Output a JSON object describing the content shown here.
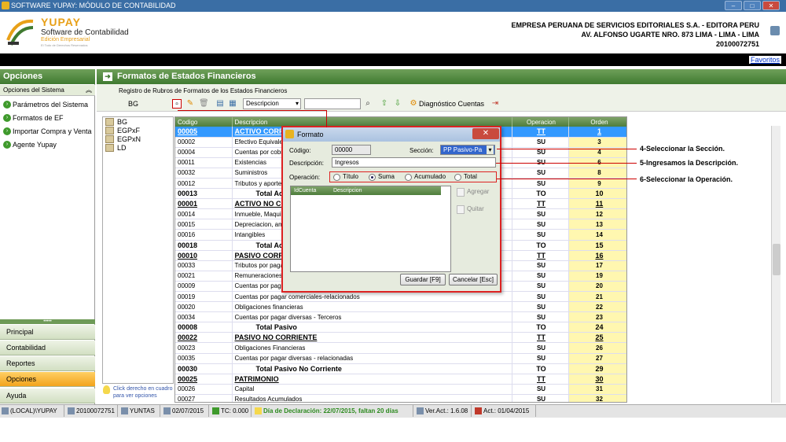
{
  "window": {
    "title": "SOFTWARE YUPAY: MÓDULO DE CONTABILIDAD",
    "min": "–",
    "max": "□",
    "close": "✕"
  },
  "brand": {
    "name": "YUPAY",
    "subtitle": "Software de Contabilidad",
    "edition": "Edición Empresarial",
    "tagline": "El Todo de Derechos Reservados"
  },
  "company": {
    "name": "EMPRESA PERUANA DE SERVICIOS EDITORIALES S.A. - EDITORA PERU",
    "address": "AV. ALFONSO UGARTE NRO. 873 LIMA - LIMA - LIMA",
    "ruc": "20100072751"
  },
  "favoritos": "Favoritos",
  "sidebar": {
    "header": "Opciones",
    "section": "Opciones del Sistema",
    "items": [
      {
        "label": "Parámetros del Sistema"
      },
      {
        "label": "Formatos de EF"
      },
      {
        "label": "Importar Compra y Venta"
      },
      {
        "label": "Agente Yupay"
      }
    ],
    "nav": [
      {
        "label": "Principal"
      },
      {
        "label": "Contabilidad"
      },
      {
        "label": "Reportes"
      },
      {
        "label": "Opciones"
      },
      {
        "label": "Ayuda"
      }
    ]
  },
  "main": {
    "title": "Formatos de Estados Financieros",
    "subtitle": "Registro de Rubros de Formatos de los Estados Financieros",
    "current_format": "BG",
    "search_field": "Descripcion",
    "diag": "Diagnóstico Cuentas"
  },
  "tree": [
    "BG",
    "EGPxF",
    "EGPxN",
    "LD"
  ],
  "hint": "Click derecho en cuadro para ver opciones",
  "grid": {
    "headers": [
      "Codigo",
      "Descripcion",
      "Operacion",
      "Orden"
    ],
    "rows": [
      [
        "00005",
        "ACTIVO CORRIENTE",
        "TT",
        "1"
      ],
      [
        "00002",
        "Efectivo Equivalente de Efectivo",
        "SU",
        "3"
      ],
      [
        "00004",
        "Cuentas por cobrar",
        "SU",
        "4"
      ],
      [
        "00011",
        "Existencias",
        "SU",
        "6"
      ],
      [
        "00032",
        "Suministros",
        "SU",
        "8"
      ],
      [
        "00012",
        "Tributos y aportes",
        "SU",
        "9"
      ],
      [
        "00013",
        "Total Activo Corriente",
        "TO",
        "10"
      ],
      [
        "00001",
        "ACTIVO NO CORRIENTE",
        "TT",
        "11"
      ],
      [
        "00014",
        "Inmueble, Maquinaria y Equipo",
        "SU",
        "12"
      ],
      [
        "00015",
        "Depreciacion, amortizacion",
        "SU",
        "13"
      ],
      [
        "00016",
        "Intangibles",
        "SU",
        "14"
      ],
      [
        "00018",
        "Total Activo No Corriente",
        "TO",
        "15"
      ],
      [
        "00010",
        "PASIVO CORRIENTE",
        "TT",
        "16"
      ],
      [
        "00033",
        "Tributos por pagar",
        "SU",
        "17"
      ],
      [
        "00021",
        "Remuneraciones",
        "SU",
        "19"
      ],
      [
        "00009",
        "Cuentas por pagar",
        "SU",
        "20"
      ],
      [
        "00019",
        "Cuentas por pagar comerciales-relacionados",
        "SU",
        "21"
      ],
      [
        "00020",
        "Obligaciones financieras",
        "SU",
        "22"
      ],
      [
        "00034",
        "Cuentas por pagar diversas - Terceros",
        "SU",
        "23"
      ],
      [
        "00008",
        "Total Pasivo",
        "TO",
        "24"
      ],
      [
        "00022",
        "PASIVO NO CORRIENTE",
        "TT",
        "25"
      ],
      [
        "00023",
        "Obligaciones Financieras",
        "SU",
        "26"
      ],
      [
        "00035",
        "Cuentas por pagar diversas - relacionadas",
        "SU",
        "27"
      ],
      [
        "00030",
        "Total Pasivo No Corriente",
        "TO",
        "29"
      ],
      [
        "00025",
        "PATRIMONIO",
        "TT",
        "30"
      ],
      [
        "00026",
        "Capital",
        "SU",
        "31"
      ],
      [
        "00027",
        "Resultados Acumulados",
        "SU",
        "32"
      ]
    ]
  },
  "dialog": {
    "title": "Formato",
    "codigo_label": "Código:",
    "codigo": "00000",
    "seccion_label": "Sección:",
    "seccion": "PP  Pasivo-Pa",
    "desc_label": "Descripción:",
    "desc": "Ingresos",
    "op_label": "Operación:",
    "ops": [
      "Título",
      "Suma",
      "Acumulado",
      "Total"
    ],
    "acct_headers": [
      "IdCuenta",
      "Descripcion"
    ],
    "agregar": "Agregar",
    "quitar": "Quitar",
    "guardar": "Guardar [F9]",
    "cancelar": "Cancelar [Esc]"
  },
  "annotations": [
    "4-Seleccionar la Sección.",
    "5-Ingresamos la Descripción.",
    "6-Seleccionar la Operación."
  ],
  "status": {
    "server": "(LOCAL)\\YUPAY",
    "ruc": "20100072751",
    "user": "YUNTAS",
    "date": "02/07/2015",
    "tc": "TC: 0.000",
    "decl": "Día de Declaración: 22/07/2015, faltan 20 días",
    "ver": "Ver.Act.: 1.6.08",
    "act": "Act.: 01/04/2015"
  },
  "colors": {
    "green": "#3f7a30",
    "accent": "#f2a31d",
    "highlight": "#3399ff",
    "annotation": "#cc0000"
  }
}
